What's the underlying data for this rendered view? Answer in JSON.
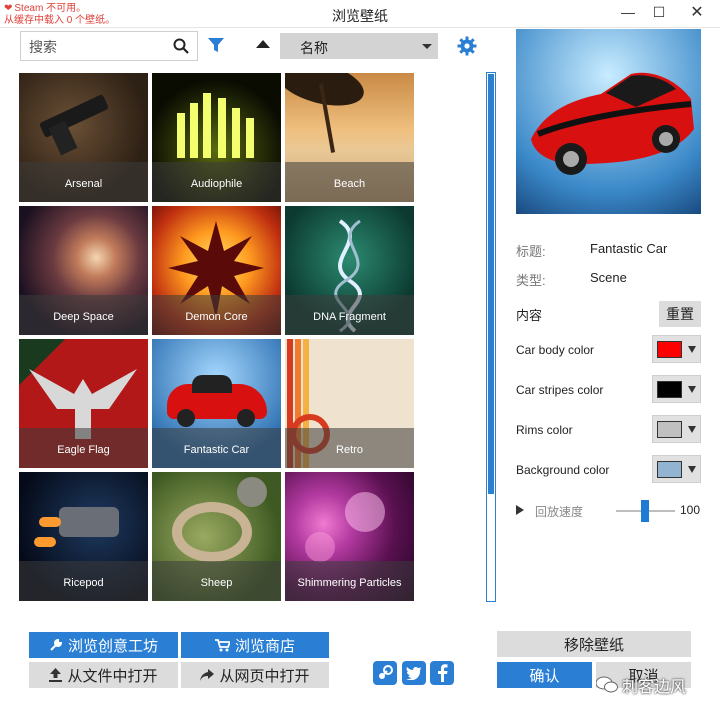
{
  "window": {
    "title": "浏览壁纸",
    "steam_warning_line1": "Steam 不可用。",
    "steam_warning_line2": "从缓存中载入 0 个壁纸。",
    "min_glyph": "—",
    "max_glyph": "☐",
    "close_glyph": "✕"
  },
  "toolbar": {
    "search_placeholder": "搜索",
    "sort_value": "名称"
  },
  "wallpapers": [
    {
      "label": "Arsenal"
    },
    {
      "label": "Audiophile"
    },
    {
      "label": "Beach"
    },
    {
      "label": "Deep Space"
    },
    {
      "label": "Demon Core"
    },
    {
      "label": "DNA Fragment"
    },
    {
      "label": "Eagle Flag"
    },
    {
      "label": "Fantastic Car",
      "selected": true
    },
    {
      "label": "Retro"
    },
    {
      "label": "Ricepod"
    },
    {
      "label": "Sheep"
    },
    {
      "label": "Shimmering Particles"
    }
  ],
  "details": {
    "title_key": "标题:",
    "title_value": "Fantastic Car",
    "type_key": "类型:",
    "type_value": "Scene",
    "content_heading": "内容",
    "reset_label": "重置",
    "properties": [
      {
        "label": "Car body color",
        "color": "#ff0000"
      },
      {
        "label": "Car stripes color",
        "color": "#000000"
      },
      {
        "label": "Rims color",
        "color": "#c0c0c0"
      },
      {
        "label": "Background color",
        "color": "#92b4d0"
      }
    ],
    "speed_label": "回放速度",
    "speed_value": "100"
  },
  "buttons": {
    "workshop": "浏览创意工坊",
    "store": "浏览商店",
    "open_file": "从文件中打开",
    "open_web": "从网页中打开",
    "remove": "移除壁纸",
    "ok": "确认",
    "cancel": "取消"
  },
  "social": [
    "steam-icon",
    "twitter-icon",
    "facebook-icon"
  ],
  "watermark": "刺客边风",
  "colors": {
    "accent": "#2a7fd4"
  }
}
